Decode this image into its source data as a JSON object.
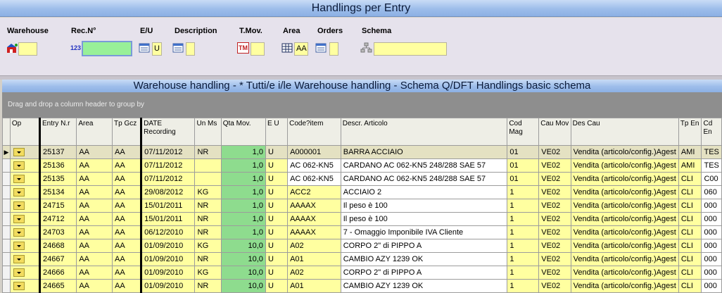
{
  "window": {
    "title": "Handlings per Entry"
  },
  "filters": {
    "warehouse": {
      "label": "Warehouse",
      "value": "",
      "icon": "warehouse-icon"
    },
    "rec_n": {
      "label": "Rec.N°",
      "value": "",
      "icon": "numbering-icon",
      "icon_text": "123"
    },
    "e_u": {
      "label": "E/U",
      "value": "U",
      "icon": "list-select-icon"
    },
    "description": {
      "label": "Description",
      "value": "",
      "icon": "list-select-icon"
    },
    "t_mov": {
      "label": "T.Mov.",
      "value": "",
      "icon": "movement-type-icon",
      "icon_text": "TM"
    },
    "area": {
      "label": "Area",
      "value": "AA",
      "icon": "grid-icon"
    },
    "orders": {
      "label": "Orders",
      "value": "",
      "icon": "list-select-icon"
    },
    "schema": {
      "label": "Schema",
      "value": "",
      "icon": "hierarchy-icon"
    }
  },
  "grid": {
    "title": "Warehouse handling - * Tutti/e i/le Warehouse handling - Schema Q/DFT Handlings basic schema",
    "group_hint": "Drag and drop a column header to group by",
    "columns": [
      "Op",
      "Entry N.r",
      "Area",
      "Tp Gcz",
      "DATE Recording",
      "Un Ms",
      "Qta Mov.",
      "E U",
      "Code?item",
      "Descr. Articolo",
      "Cod Mag",
      "Cau Mov",
      "Des Cau",
      "Tp En",
      "Cd En"
    ],
    "current_row_marker": "▶",
    "rows": [
      {
        "entry": "25137",
        "area": "AA",
        "tp": "AA",
        "date": "07/11/2012",
        "um": "NR",
        "qta": "1,0",
        "eu": "U",
        "code": "A000001",
        "descr": "BARRA ACCIAIO",
        "mag": "01",
        "cau": "VE02",
        "des": "Vendita (articolo/config.)Agest",
        "tpen": "AMI",
        "cden": "TES"
      },
      {
        "entry": "25136",
        "area": "AA",
        "tp": "AA",
        "date": "07/11/2012",
        "um": "",
        "qta": "1,0",
        "eu": "U",
        "code": "AC 062-KN5",
        "descr": "CARDANO AC 062-KN5 248/288 SAE 57",
        "mag": "01",
        "cau": "VE02",
        "des": "Vendita (articolo/config.)Agest",
        "tpen": "AMI",
        "cden": "TES"
      },
      {
        "entry": "25135",
        "area": "AA",
        "tp": "AA",
        "date": "07/11/2012",
        "um": "",
        "qta": "1,0",
        "eu": "U",
        "code": "AC 062-KN5",
        "descr": "CARDANO AC 062-KN5 248/288 SAE 57",
        "mag": "01",
        "cau": "VE02",
        "des": "Vendita (articolo/config.)Agest",
        "tpen": "CLI",
        "cden": "C00"
      },
      {
        "entry": "25134",
        "area": "AA",
        "tp": "AA",
        "date": "29/08/2012",
        "um": "KG",
        "qta": "1,0",
        "eu": "U",
        "code": "ACC2",
        "descr": "ACCIAIO 2",
        "mag": "1",
        "cau": "VE02",
        "des": "Vendita (articolo/config.)Agest",
        "tpen": "CLI",
        "cden": "060"
      },
      {
        "entry": "24715",
        "area": "AA",
        "tp": "AA",
        "date": "15/01/2011",
        "um": "NR",
        "qta": "1,0",
        "eu": "U",
        "code": "AAAAX",
        "descr": "Il peso è 100",
        "mag": "1",
        "cau": "VE02",
        "des": "Vendita (articolo/config.)Agest",
        "tpen": "CLI",
        "cden": "000"
      },
      {
        "entry": "24712",
        "area": "AA",
        "tp": "AA",
        "date": "15/01/2011",
        "um": "NR",
        "qta": "1,0",
        "eu": "U",
        "code": "AAAAX",
        "descr": "Il peso è 100",
        "mag": "1",
        "cau": "VE02",
        "des": "Vendita (articolo/config.)Agest",
        "tpen": "CLI",
        "cden": "000"
      },
      {
        "entry": "24703",
        "area": "AA",
        "tp": "AA",
        "date": "06/12/2010",
        "um": "NR",
        "qta": "1,0",
        "eu": "U",
        "code": "AAAAX",
        "descr": "7 - Omaggio Imponibile IVA Cliente",
        "mag": "1",
        "cau": "VE02",
        "des": "Vendita (articolo/config.)Agest",
        "tpen": "CLI",
        "cden": "000"
      },
      {
        "entry": "24668",
        "area": "AA",
        "tp": "AA",
        "date": "01/09/2010",
        "um": "KG",
        "qta": "10,0",
        "eu": "U",
        "code": "A02",
        "descr": "CORPO 2\" di PIPPO A",
        "mag": "1",
        "cau": "VE02",
        "des": "Vendita (articolo/config.)Agest",
        "tpen": "CLI",
        "cden": "000"
      },
      {
        "entry": "24667",
        "area": "AA",
        "tp": "AA",
        "date": "01/09/2010",
        "um": "NR",
        "qta": "10,0",
        "eu": "U",
        "code": "A01",
        "descr": "CAMBIO AZY 1239   OK",
        "mag": "1",
        "cau": "VE02",
        "des": "Vendita (articolo/config.)Agest",
        "tpen": "CLI",
        "cden": "000"
      },
      {
        "entry": "24666",
        "area": "AA",
        "tp": "AA",
        "date": "01/09/2010",
        "um": "KG",
        "qta": "10,0",
        "eu": "U",
        "code": "A02",
        "descr": "CORPO 2\" di PIPPO A",
        "mag": "1",
        "cau": "VE02",
        "des": "Vendita (articolo/config.)Agest",
        "tpen": "CLI",
        "cden": "000"
      },
      {
        "entry": "24665",
        "area": "AA",
        "tp": "AA",
        "date": "01/09/2010",
        "um": "NR",
        "qta": "10,0",
        "eu": "U",
        "code": "A01",
        "descr": "CAMBIO AZY 1239   OK",
        "mag": "1",
        "cau": "VE02",
        "des": "Vendita (articolo/config.)Agest",
        "tpen": "CLI",
        "cden": "000"
      }
    ]
  },
  "colors": {
    "title_bar": "#9dbdea",
    "filter_field": "#ffffa0",
    "rec_field": "#98f098",
    "qty_cell": "#8edc8e",
    "group_bar": "#8e8e8e"
  }
}
